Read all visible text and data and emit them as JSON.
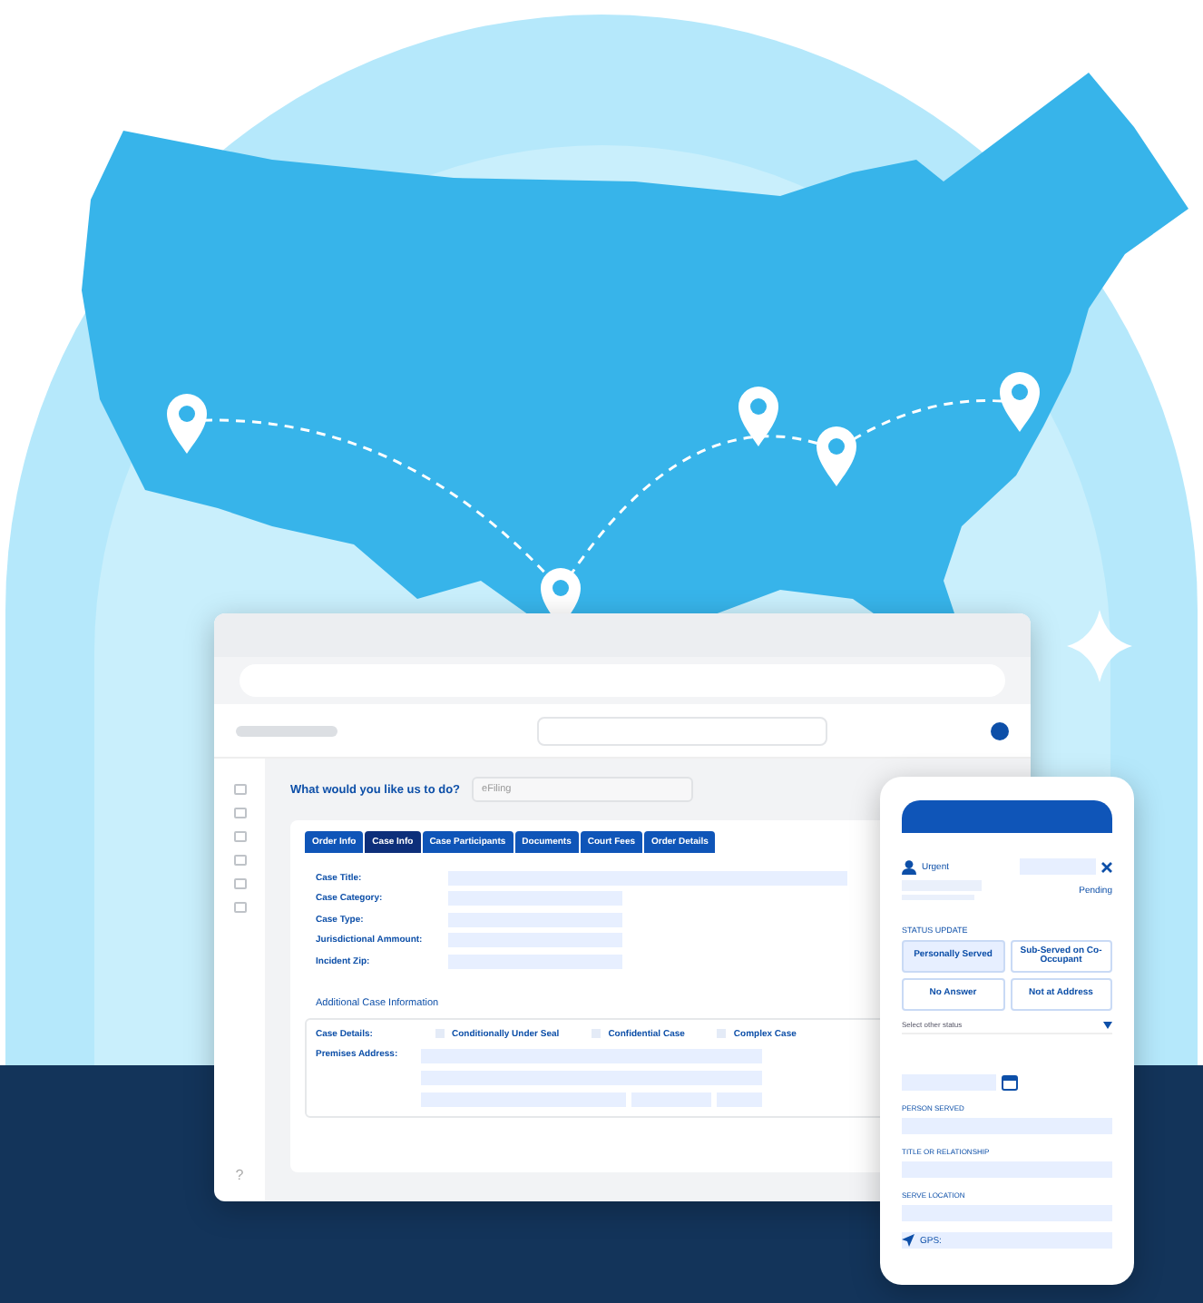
{
  "desktop": {
    "question": "What would you like us to do?",
    "dropdown_value": "eFiling",
    "tabs": [
      {
        "label": "Order Info",
        "selected": false
      },
      {
        "label": "Case Info",
        "selected": true
      },
      {
        "label": "Case Participants",
        "selected": false
      },
      {
        "label": "Documents",
        "selected": false
      },
      {
        "label": "Court Fees",
        "selected": false
      },
      {
        "label": "Order Details",
        "selected": false
      }
    ],
    "fields": [
      {
        "label": "Case Title:",
        "kind": "wide"
      },
      {
        "label": "Case Category:",
        "kind": "short"
      },
      {
        "label": "Case Type:",
        "kind": "short"
      },
      {
        "label": "Jurisdictional Ammount:",
        "kind": "short"
      },
      {
        "label": "Incident Zip:",
        "kind": "short"
      }
    ],
    "section_title": "Additional Case Information",
    "details_label": "Case Details:",
    "checkboxes": [
      {
        "label": "Conditionally Under Seal",
        "checked": false
      },
      {
        "label": "Confidential Case",
        "checked": false
      },
      {
        "label": "Complex Case",
        "checked": false
      }
    ],
    "address_label": "Premises Address:",
    "help": "?"
  },
  "phone": {
    "priority": "Urgent",
    "status": "Pending",
    "status_heading": "STATUS UPDATE",
    "status_options": [
      {
        "label": "Personally Served",
        "selected": true
      },
      {
        "label": "Sub-Served on Co-Occupant",
        "selected": false
      },
      {
        "label": "No Answer",
        "selected": false
      },
      {
        "label": "Not at Address",
        "selected": false
      }
    ],
    "select_placeholder": "Select other status",
    "field_labels": [
      "PERSON SERVED",
      "TITLE OR RELATIONSHIP",
      "SERVE LOCATION"
    ],
    "gps_label": "GPS:"
  }
}
